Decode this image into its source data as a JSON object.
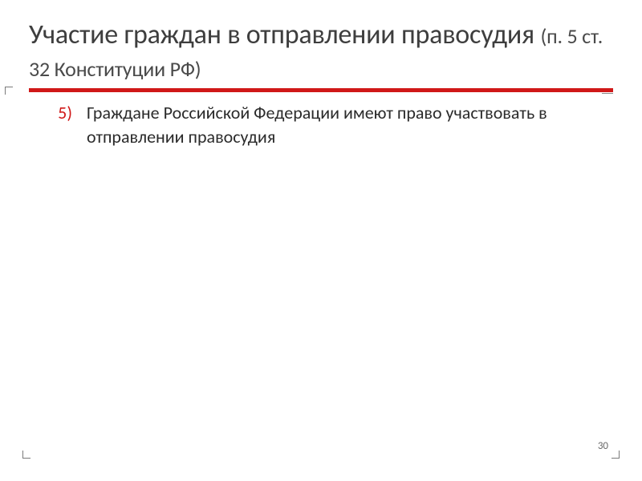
{
  "title": {
    "main": "Участие граждан в отправлении правосудия ",
    "sub": "(п. 5 ст. 32 Конституции РФ)"
  },
  "list": {
    "num": "5)",
    "text": "Граждане Российской Федерации имеют право участвовать в отправлении правосудия"
  },
  "page": "30",
  "colors": {
    "accent": "#d01818"
  }
}
